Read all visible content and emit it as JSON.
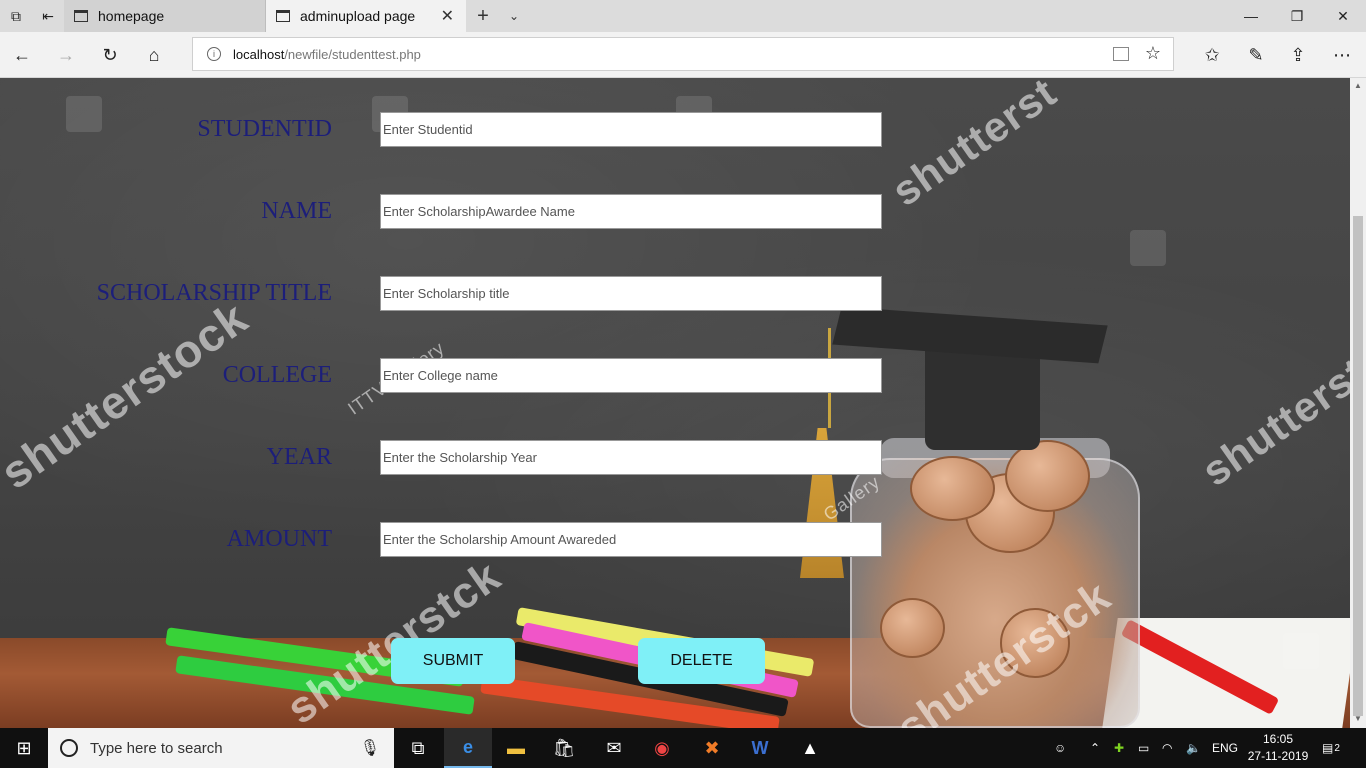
{
  "browser": {
    "tabs": [
      {
        "label": "homepage",
        "active": false
      },
      {
        "label": "adminupload page",
        "active": true
      }
    ],
    "url_host": "localhost",
    "url_path": "/newfile/studenttest.php"
  },
  "form": {
    "fields": [
      {
        "label": "STUDENTID",
        "placeholder": "Enter Studentid"
      },
      {
        "label": "NAME",
        "placeholder": "Enter ScholarshipAwardee Name"
      },
      {
        "label": "SCHOLARSHIP TITLE",
        "placeholder": "Enter Scholarship title"
      },
      {
        "label": "COLLEGE",
        "placeholder": "Enter College name"
      },
      {
        "label": "YEAR",
        "placeholder": "Enter the Scholarship Year"
      },
      {
        "label": "AMOUNT",
        "placeholder": "Enter the Scholarship Amount Awareded"
      }
    ],
    "submit_label": "SUBMIT",
    "delete_label": "DELETE"
  },
  "background": {
    "watermark_text": "shutterstock",
    "watermark_fragment": "shutterst",
    "watermark_fragment2": "shutterstck",
    "gallery_text": "ITTV Gallery",
    "gallery_text2": "Gallery"
  },
  "taskbar": {
    "search_placeholder": "Type here to search",
    "language": "ENG",
    "time": "16:05",
    "date": "27-11-2019",
    "notification_count": "2"
  },
  "colors": {
    "label": "#1c1e7a",
    "button": "#7ff0f7"
  }
}
